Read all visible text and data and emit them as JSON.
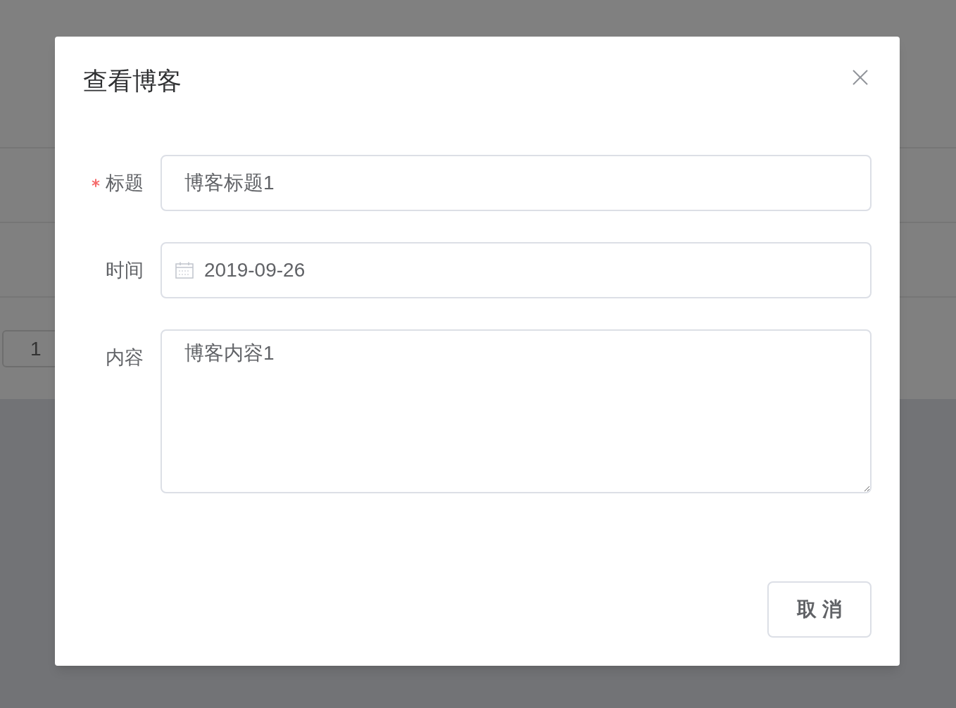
{
  "background": {
    "pager_value": "1"
  },
  "dialog": {
    "title": "查看博客",
    "fields": [
      {
        "kind": "text",
        "label": "标题",
        "required": true,
        "value": "博客标题1"
      },
      {
        "kind": "date",
        "label": "时间",
        "required": false,
        "value": "2019-09-26"
      },
      {
        "kind": "textarea",
        "label": "内容",
        "required": false,
        "value": "博客内容1"
      }
    ],
    "buttons": [
      "取 消"
    ]
  }
}
